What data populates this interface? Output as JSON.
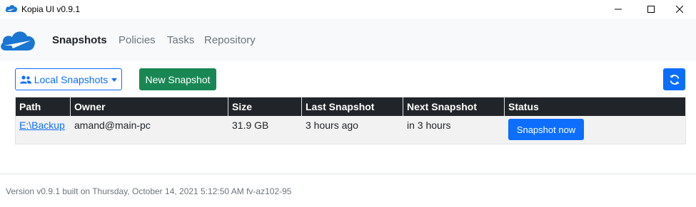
{
  "window": {
    "title": "Kopia UI v0.9.1",
    "controls": {
      "minimize": "─",
      "maximize": "☐",
      "close": "✕"
    }
  },
  "brand": {
    "icon": "kopia-cloud-icon",
    "color": "#1976d2"
  },
  "nav": {
    "items": [
      {
        "label": "Snapshots",
        "active": true
      },
      {
        "label": "Policies",
        "active": false
      },
      {
        "label": "Tasks",
        "active": false
      },
      {
        "label": "Repository",
        "active": false
      }
    ]
  },
  "toolbar": {
    "owner_dropdown": {
      "label": "Local Snapshots",
      "icon": "users-icon"
    },
    "new_snapshot_label": "New Snapshot",
    "refresh_icon": "refresh-icon"
  },
  "table": {
    "columns": [
      "Path",
      "Owner",
      "Size",
      "Last Snapshot",
      "Next Snapshot",
      "Status"
    ],
    "rows": [
      {
        "path": "E:\\Backup",
        "owner": "amand@main-pc",
        "size": "31.9 GB",
        "last_snapshot": "3 hours ago",
        "next_snapshot": "in 3 hours",
        "status_button": "Snapshot now"
      }
    ]
  },
  "footer": {
    "text": "Version v0.9.1 built on Thursday, October 14, 2021 5:12:50 AM fv-az102-95"
  },
  "colors": {
    "primary": "#0d6efd",
    "success": "#198754",
    "dark": "#212529",
    "muted": "#6c757d"
  }
}
